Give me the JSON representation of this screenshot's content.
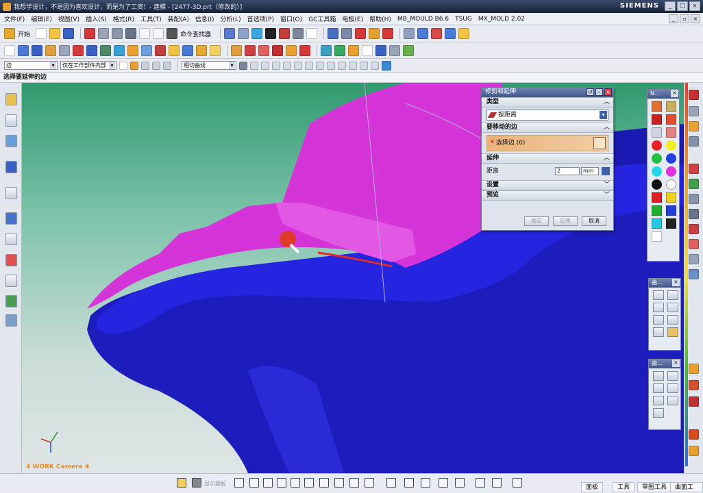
{
  "window": {
    "title": "我想学设计，不是因为喜欢设计，而是为了工资！- 建模 - [2477-3D.prt（修改的）]",
    "brand": "SIEMENS",
    "min": "_",
    "max": "□",
    "close": "×"
  },
  "menu": [
    "文件(F)",
    "编辑(E)",
    "视图(V)",
    "插入(S)",
    "格式(R)",
    "工具(T)",
    "装配(A)",
    "信息(I)",
    "分析(L)",
    "首选项(P)",
    "窗口(O)",
    "GC工具箱",
    "电极(E)",
    "帮助(H)",
    "MB_MOULD B6.6",
    "TSUG",
    "MX_MOLD 2.02"
  ],
  "toolbar": {
    "start_label": "开始",
    "command_finder": "命令查找器"
  },
  "selection_bar": {
    "filter_type": "边",
    "scope": "仅在工作部件内部",
    "curve_rule": "相切曲线"
  },
  "prompt": "选择要延伸的边",
  "viewport": {
    "camera_label": "4 WORK Camera 4",
    "colors": {
      "body": "#2424d8",
      "top": "#d534d8",
      "bg_top": "#2f9a6e",
      "bg_bottom": "#dfe6e8"
    }
  },
  "dialog": {
    "title": "修剪和延伸",
    "sections": {
      "type": "类型",
      "edges": "要移动的边",
      "extend": "延伸",
      "settings": "设置",
      "preview": "预览"
    },
    "type_value": "按距离",
    "select_edge": "选择边 (0)",
    "distance_label": "距离",
    "distance_value": "2",
    "distance_unit": "mm",
    "buttons": {
      "ok": "确定",
      "apply": "应用",
      "cancel": "取消"
    }
  },
  "palettes": {
    "render": {
      "title": "N..."
    },
    "surface": {
      "title": "曲..."
    },
    "curve": {
      "title": "曲..."
    }
  },
  "bottom": {
    "labels": [
      "显示面板"
    ],
    "tabs": [
      "面板",
      "工具",
      "草图工具",
      "曲面工具"
    ]
  }
}
